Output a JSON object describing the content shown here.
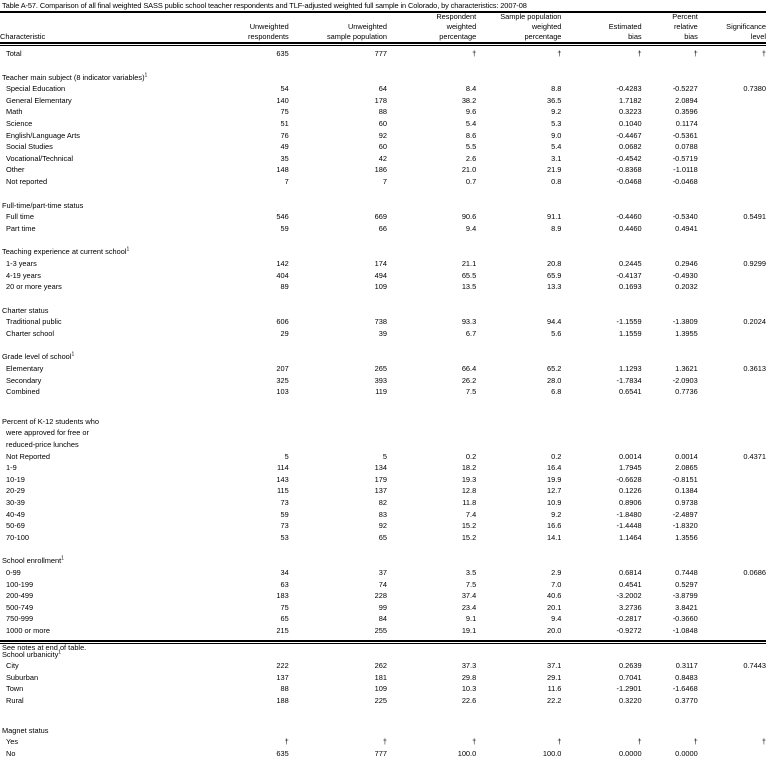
{
  "title": "Table A-57. Comparison of all final weighted SASS public school teacher respondents and TLF-adjusted weighted full sample in Colorado, by characteristics: 2007-08",
  "columns": [
    [
      "",
      "",
      "Characteristic"
    ],
    [
      "",
      "Unweighted",
      "respondents"
    ],
    [
      "",
      "Unweighted",
      "sample population"
    ],
    [
      "Respondent",
      "weighted",
      "percentage"
    ],
    [
      "Sample population",
      "weighted",
      "percentage"
    ],
    [
      "",
      "Estimated",
      "bias"
    ],
    [
      "Percent",
      "relative",
      "bias"
    ],
    [
      "",
      "Significance",
      "level"
    ]
  ],
  "total": [
    "Total",
    "635",
    "777",
    "†",
    "†",
    "†",
    "†",
    "†"
  ],
  "sections": [
    {
      "title": [
        "Teacher main subject (8 indicator variables)"
      ],
      "sup": "1",
      "rows": [
        [
          "Special Education",
          "54",
          "64",
          "8.4",
          "8.8",
          "-0.4283",
          "-0.5227",
          "0.7380"
        ],
        [
          "General Elementary",
          "140",
          "178",
          "38.2",
          "36.5",
          "1.7182",
          "2.0894",
          ""
        ],
        [
          "Math",
          "75",
          "88",
          "9.6",
          "9.2",
          "0.3223",
          "0.3596",
          ""
        ],
        [
          "Science",
          "51",
          "60",
          "5.4",
          "5.3",
          "0.1040",
          "0.1174",
          ""
        ],
        [
          "English/Language Arts",
          "76",
          "92",
          "8.6",
          "9.0",
          "-0.4467",
          "-0.5361",
          ""
        ],
        [
          "Social Studies",
          "49",
          "60",
          "5.5",
          "5.4",
          "0.0682",
          "0.0788",
          ""
        ],
        [
          "Vocational/Technical",
          "35",
          "42",
          "2.6",
          "3.1",
          "-0.4542",
          "-0.5719",
          ""
        ],
        [
          "Other",
          "148",
          "186",
          "21.0",
          "21.9",
          "-0.8368",
          "-1.0118",
          ""
        ],
        [
          "Not reported",
          "7",
          "7",
          "0.7",
          "0.8",
          "-0.0468",
          "-0.0468",
          ""
        ]
      ]
    },
    {
      "title": [
        "Full-time/part-time status"
      ],
      "sup": "",
      "rows": [
        [
          "Full time",
          "546",
          "669",
          "90.6",
          "91.1",
          "-0.4460",
          "-0.5340",
          "0.5491"
        ],
        [
          "Part time",
          "59",
          "66",
          "9.4",
          "8.9",
          "0.4460",
          "0.4941",
          ""
        ]
      ]
    },
    {
      "title": [
        "Teaching experience at current school"
      ],
      "sup": "1",
      "rows": [
        [
          "1-3 years",
          "142",
          "174",
          "21.1",
          "20.8",
          "0.2445",
          "0.2946",
          "0.9299"
        ],
        [
          "4-19 years",
          "404",
          "494",
          "65.5",
          "65.9",
          "-0.4137",
          "-0.4930",
          ""
        ],
        [
          "20 or more years",
          "89",
          "109",
          "13.5",
          "13.3",
          "0.1693",
          "0.2032",
          ""
        ]
      ]
    },
    {
      "title": [
        "Charter status"
      ],
      "sup": "",
      "rows": [
        [
          "Traditional public",
          "606",
          "738",
          "93.3",
          "94.4",
          "-1.1559",
          "-1.3809",
          "0.2024"
        ],
        [
          "Charter school",
          "29",
          "39",
          "6.7",
          "5.6",
          "1.1559",
          "1.3955",
          ""
        ]
      ]
    },
    {
      "title": [
        "Grade level of school"
      ],
      "sup": "1",
      "rows": [
        [
          "Elementary",
          "207",
          "265",
          "66.4",
          "65.2",
          "1.1293",
          "1.3621",
          "0.3613"
        ],
        [
          "Secondary",
          "325",
          "393",
          "26.2",
          "28.0",
          "-1.7834",
          "-2.0903",
          ""
        ],
        [
          "Combined",
          "103",
          "119",
          "7.5",
          "6.8",
          "0.6541",
          "0.7736",
          ""
        ]
      ]
    },
    {
      "title": [
        "Percent of K-12 students who",
        "were approved for free or",
        "reduced-price lunches"
      ],
      "sup": "",
      "extraGap": true,
      "rows": [
        [
          "Not Reported",
          "5",
          "5",
          "0.2",
          "0.2",
          "0.0014",
          "0.0014",
          "0.4371"
        ],
        [
          "1-9",
          "114",
          "134",
          "18.2",
          "16.4",
          "1.7945",
          "2.0865",
          ""
        ],
        [
          "10-19",
          "143",
          "179",
          "19.3",
          "19.9",
          "-0.6628",
          "-0.8151",
          ""
        ],
        [
          "20-29",
          "115",
          "137",
          "12.8",
          "12.7",
          "0.1226",
          "0.1384",
          ""
        ],
        [
          "30-39",
          "73",
          "82",
          "11.8",
          "10.9",
          "0.8906",
          "0.9738",
          ""
        ],
        [
          "40-49",
          "59",
          "83",
          "7.4",
          "9.2",
          "-1.8480",
          "-2.4897",
          ""
        ],
        [
          "50-69",
          "73",
          "92",
          "15.2",
          "16.6",
          "-1.4448",
          "-1.8320",
          ""
        ],
        [
          "70-100",
          "53",
          "65",
          "15.2",
          "14.1",
          "1.1464",
          "1.3556",
          ""
        ]
      ]
    },
    {
      "title": [
        "School enrollment"
      ],
      "sup": "1",
      "rows": [
        [
          "0-99",
          "34",
          "37",
          "3.5",
          "2.9",
          "0.6814",
          "0.7448",
          "0.0686"
        ],
        [
          "100-199",
          "63",
          "74",
          "7.5",
          "7.0",
          "0.4541",
          "0.5297",
          ""
        ],
        [
          "200-499",
          "183",
          "228",
          "37.4",
          "40.6",
          "-3.2002",
          "-3.8799",
          ""
        ],
        [
          "500-749",
          "75",
          "99",
          "23.4",
          "20.1",
          "3.2736",
          "3.8421",
          ""
        ],
        [
          "750-999",
          "65",
          "84",
          "9.1",
          "9.4",
          "-0.2817",
          "-0.3660",
          ""
        ],
        [
          "1000 or more",
          "215",
          "255",
          "19.1",
          "20.0",
          "-0.9272",
          "-1.0848",
          ""
        ]
      ]
    },
    {
      "title": [
        "School urbanicity"
      ],
      "sup": "1",
      "rows": [
        [
          "City",
          "222",
          "262",
          "37.3",
          "37.1",
          "0.2639",
          "0.3117",
          "0.7443"
        ],
        [
          "Suburban",
          "137",
          "181",
          "29.8",
          "29.1",
          "0.7041",
          "0.8483",
          ""
        ],
        [
          "Town",
          "88",
          "109",
          "10.3",
          "11.6",
          "-1.2901",
          "-1.6468",
          ""
        ],
        [
          "Rural",
          "188",
          "225",
          "22.6",
          "22.2",
          "0.3220",
          "0.3770",
          ""
        ]
      ]
    },
    {
      "title": [
        "Magnet status"
      ],
      "sup": "",
      "extraGap": true,
      "rows": [
        [
          "Yes",
          "†",
          "†",
          "†",
          "†",
          "†",
          "†",
          "†"
        ],
        [
          "No",
          "635",
          "777",
          "100.0",
          "100.0",
          "0.0000",
          "0.0000",
          ""
        ]
      ]
    }
  ],
  "notes": "See notes at end of table."
}
